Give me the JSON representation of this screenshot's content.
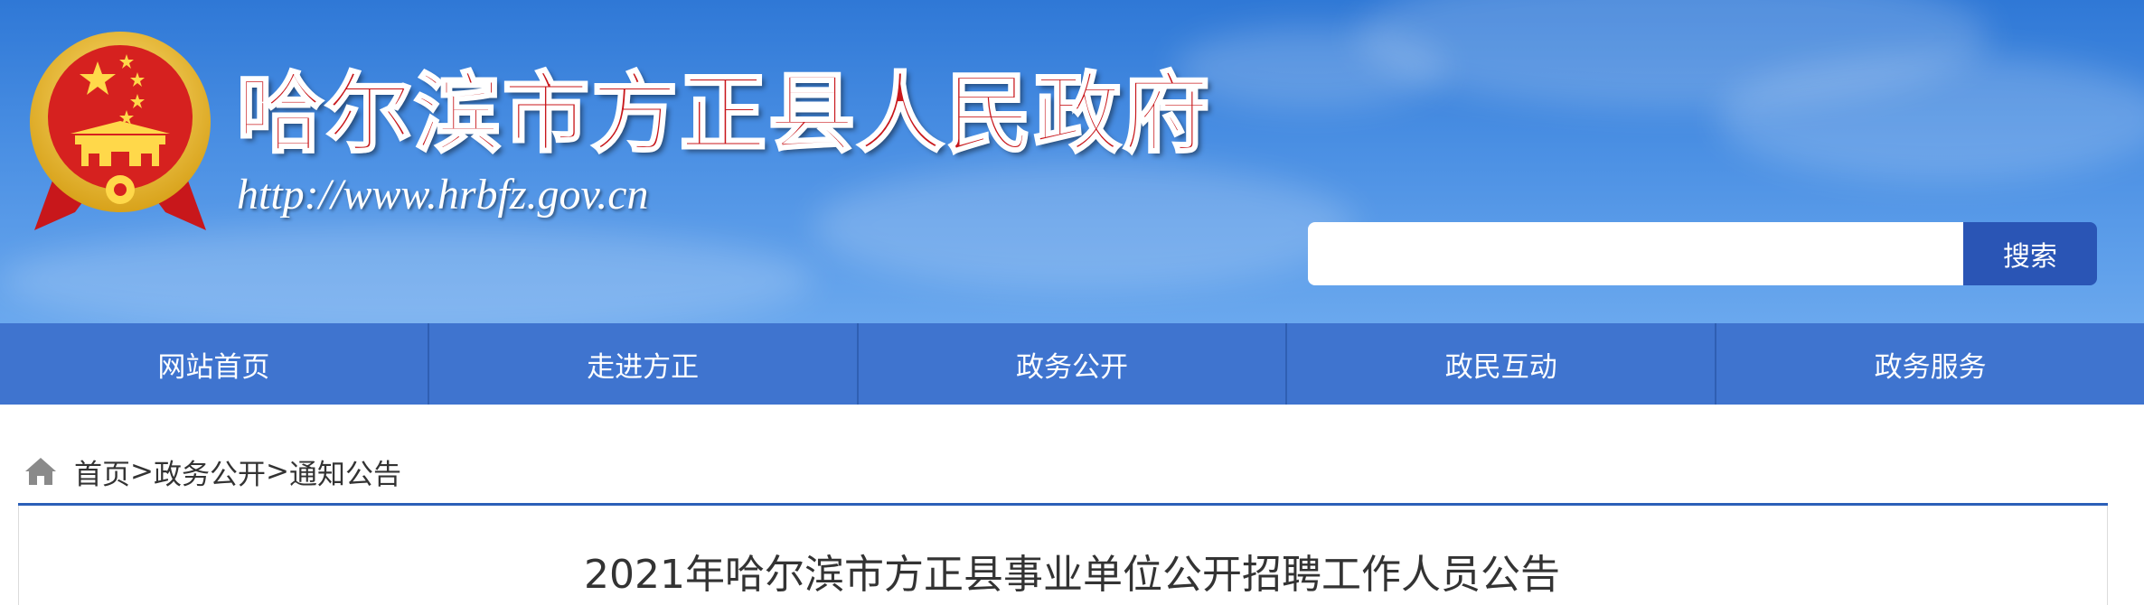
{
  "header": {
    "site_title": "哈尔滨市方正县人民政府",
    "site_url": "http://www.hrbfz.gov.cn",
    "emblem_icon": "national-emblem-icon"
  },
  "search": {
    "value": "",
    "placeholder": "",
    "button_label": "搜索"
  },
  "nav": {
    "items": [
      {
        "label": "网站首页"
      },
      {
        "label": "走进方正"
      },
      {
        "label": "政务公开"
      },
      {
        "label": "政民互动"
      },
      {
        "label": "政务服务"
      }
    ]
  },
  "breadcrumb": {
    "icon": "home-icon",
    "items": [
      "首页",
      "政务公开",
      "通知公告"
    ],
    "separator": ">"
  },
  "article": {
    "title": "2021年哈尔滨市方正县事业单位公开招聘工作人员公告"
  },
  "colors": {
    "banner_blue": "#3a82dc",
    "nav_blue": "#3f74cf",
    "search_button": "#2a55b5",
    "title_red": "#c8171b",
    "divider_blue": "#2b5fb8"
  }
}
